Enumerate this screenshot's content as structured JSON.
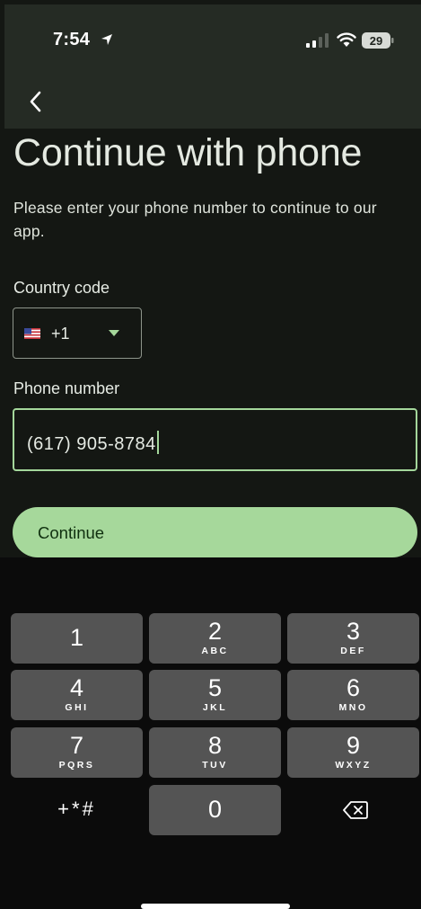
{
  "status_bar": {
    "time": "7:54",
    "battery": "29"
  },
  "screen": {
    "title": "Continue with phone",
    "subtitle": "Please enter your phone number to continue to our app.",
    "country_label": "Country code",
    "country_code": "+1",
    "phone_label": "Phone number",
    "phone_value": "(617) 905-8784",
    "continue_label": "Continue"
  },
  "keyboard": {
    "keys": [
      {
        "digit": "1",
        "letters": ""
      },
      {
        "digit": "2",
        "letters": "ABC"
      },
      {
        "digit": "3",
        "letters": "DEF"
      },
      {
        "digit": "4",
        "letters": "GHI"
      },
      {
        "digit": "5",
        "letters": "JKL"
      },
      {
        "digit": "6",
        "letters": "MNO"
      },
      {
        "digit": "7",
        "letters": "PQRS"
      },
      {
        "digit": "8",
        "letters": "TUV"
      },
      {
        "digit": "9",
        "letters": "WXYZ"
      }
    ],
    "symbols": "+*#",
    "zero": "0"
  },
  "colors": {
    "accent": "#a6d89b",
    "background": "#141713",
    "header": "#252b24",
    "key": "#545454"
  },
  "icons": [
    "location-arrow-icon",
    "signal-icon",
    "wifi-icon",
    "battery-icon",
    "back-chevron-icon",
    "us-flag-icon",
    "dropdown-caret-icon",
    "backspace-icon"
  ]
}
